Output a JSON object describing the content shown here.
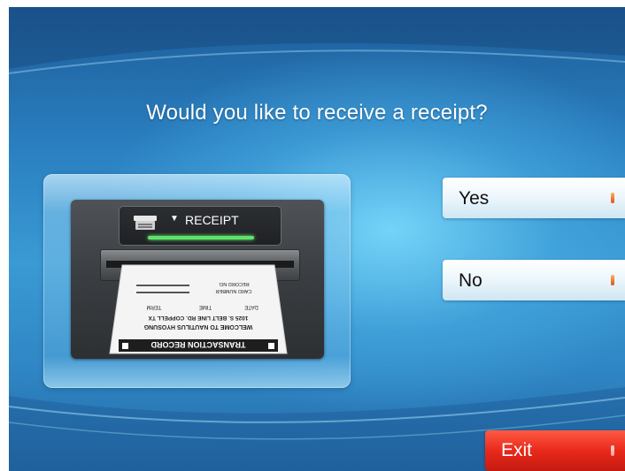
{
  "screen": {
    "question": "Would you like to receive a receipt?"
  },
  "illustration": {
    "slot_label": "RECEIPT",
    "receipt_lines": [
      "TRANSACTION RECORD",
      "WELCOME TO NAUTILUS HYOSUNG",
      "1025 S. BELT LINE RD. COPPELL TX",
      "DATE",
      "TIME",
      "TERM",
      "CARD NUMBER",
      "RECORD NO."
    ]
  },
  "buttons": {
    "yes": "Yes",
    "no": "No",
    "exit": "Exit"
  },
  "colors": {
    "background": "#2a7fc0",
    "exit_button": "#e8291b",
    "status_bar": "#5fe36a"
  },
  "icons": {
    "printer": "printer-icon",
    "arrow": "triangle-down-icon"
  }
}
